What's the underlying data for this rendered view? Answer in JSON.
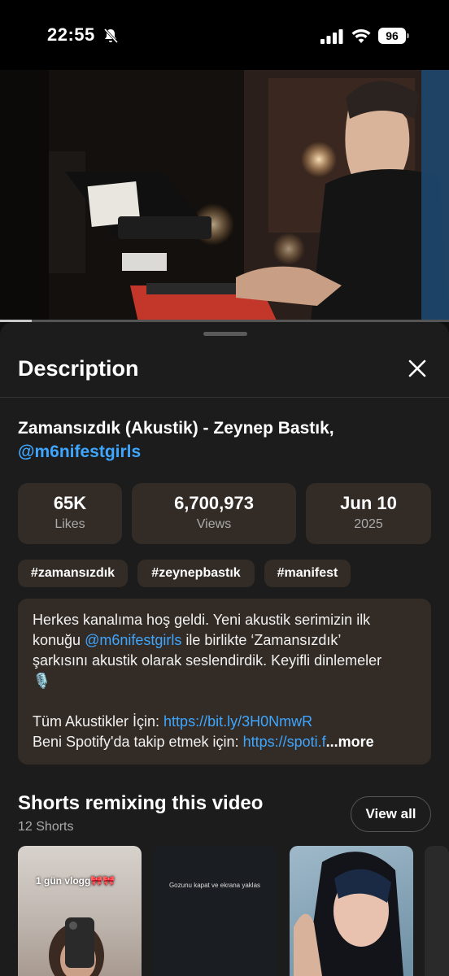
{
  "status_bar": {
    "time": "22:55",
    "battery": "96"
  },
  "video": {
    "progress_fraction": 0.07
  },
  "sheet": {
    "title": "Description",
    "video_title": "Zamansızdık (Akustik) - Zeynep Bastık,",
    "video_title_mention": "@m6nifestgirls",
    "stats": [
      {
        "value": "65K",
        "label": "Likes"
      },
      {
        "value": "6,700,973",
        "label": "Views"
      },
      {
        "value": "Jun 10",
        "label": "2025"
      }
    ],
    "tags": [
      "#zamansızdık",
      "#zeynepbastık",
      "#manifest"
    ],
    "description": {
      "line1": "Herkes kanalıma hoş geldi. Yeni akustik serimizin ilk",
      "line2_prefix": "konuğu ",
      "line2_mention": "@m6nifestgirls",
      "line2_suffix": " ile birlikte ‘Zamansızdık’",
      "line3": "şarkısını akustik olarak seslendirdik. Keyifli dinlemeler",
      "line4_emoji": "🎙️",
      "line6_prefix": "Tüm Akustikler İçin: ",
      "line6_link": "https://bit.ly/3H0NmwR",
      "line7_prefix": "Beni Spotify'da takip etmek için: ",
      "line7_link": "https://spoti.f",
      "more_label": "...more"
    },
    "shorts": {
      "title": "Shorts remixing this video",
      "count": "12 Shorts",
      "view_all_label": "View all",
      "thumb_captions": [
        "1 gün vlogg🎀🎀",
        "Gozunu kapat ve ekrana yaklas"
      ]
    }
  },
  "colors": {
    "accent_link": "#3ea6ff",
    "card_bg": "#332b25",
    "sheet_bg": "#1c1c1c"
  }
}
